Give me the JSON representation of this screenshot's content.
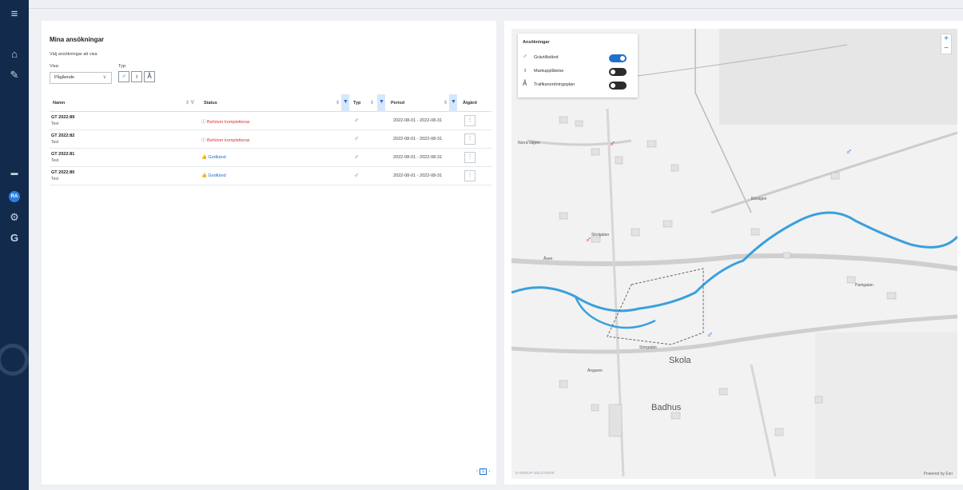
{
  "sidebar": {
    "icons": [
      "menu-icon",
      "home-icon",
      "edit-icon",
      "card-icon",
      "avatar",
      "settings-icon",
      "brand-icon"
    ],
    "avatar_initials": "RA"
  },
  "left": {
    "title": "Mina ansökningar",
    "subtitle": "Välj ansökningar att visa",
    "visa_label": "Visa:",
    "typ_label": "Typ:",
    "visa_value": "Pågående",
    "columns": [
      "Namn",
      "Status",
      "Typ",
      "Period",
      "Åtgärd"
    ],
    "rows": [
      {
        "name": "GT 2022:89",
        "sub": "Test",
        "status": "Behöver kompletteras",
        "status_kind": "red",
        "period": "2022-08-01 - 2022-08-31"
      },
      {
        "name": "GT 2022:82",
        "sub": "Test",
        "status": "Behöver kompletteras",
        "status_kind": "red",
        "period": "2022-08-01 - 2022-08-31"
      },
      {
        "name": "GT 2022:81",
        "sub": "Test",
        "status": "Godkänd",
        "status_kind": "blue",
        "period": "2022-08-01 - 2022-08-31"
      },
      {
        "name": "GT 2022:80",
        "sub": "Test",
        "status": "Godkänd",
        "status_kind": "blue",
        "period": "2022-08-01 - 2022-08-31"
      }
    ],
    "page": "1"
  },
  "map": {
    "layers_title": "Ansökningar",
    "layers": [
      {
        "label": "Grävtillstånd",
        "on": true
      },
      {
        "label": "Markupplåtelse",
        "on": false
      },
      {
        "label": "Trafikanordningsplan",
        "on": false
      }
    ],
    "zoom_in": "+",
    "zoom_out": "−",
    "labels": [
      "Norra vägen",
      "Skola",
      "Badhus",
      "Ängaren",
      "Storgatan",
      "Åsen",
      "Skolgatan",
      "Parkgatan",
      "Ekvägen"
    ],
    "brand": "G-GROUP SOLUTIONS",
    "powered": "Powered by Esri"
  },
  "colors": {
    "accent": "#1e6fd0",
    "sidebar": "#122a4b",
    "danger": "#d13438"
  }
}
